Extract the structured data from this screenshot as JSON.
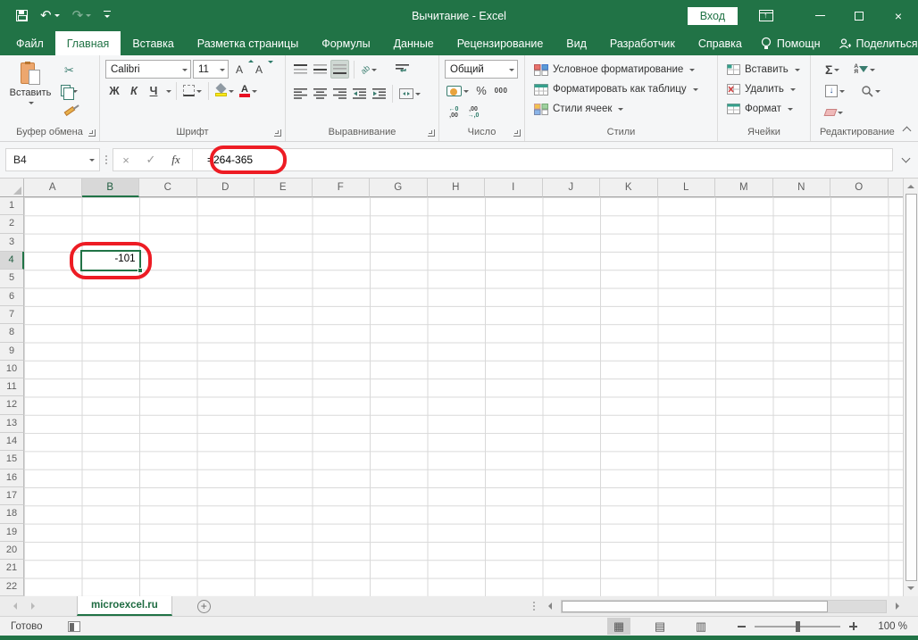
{
  "titlebar": {
    "title": "Вычитание - Excel",
    "signin_label": "Вход"
  },
  "ribbon_tabs": [
    {
      "label": "Файл"
    },
    {
      "label": "Главная"
    },
    {
      "label": "Вставка"
    },
    {
      "label": "Разметка страницы"
    },
    {
      "label": "Формулы"
    },
    {
      "label": "Данные"
    },
    {
      "label": "Рецензирование"
    },
    {
      "label": "Вид"
    },
    {
      "label": "Разработчик"
    },
    {
      "label": "Справка"
    }
  ],
  "tab_actions": {
    "assistant_label": "Помощн",
    "share_label": "Поделиться"
  },
  "ribbon": {
    "clipboard": {
      "group_label": "Буфер обмена",
      "paste_label": "Вставить"
    },
    "font": {
      "group_label": "Шрифт",
      "font_name": "Calibri",
      "font_size": "11",
      "bold_label": "Ж",
      "italic_label": "К",
      "underline_label": "Ч",
      "grow_font_label": "А",
      "shrink_font_label": "А"
    },
    "alignment": {
      "group_label": "Выравнивание",
      "wrap_hint": "ab",
      "orient_hint": "ab"
    },
    "number": {
      "group_label": "Число",
      "format_value": "Общий",
      "percent_label": "%",
      "thousands_label": "000",
      "inc_dec_top": "←0",
      "inc_dec_bottom": ",00",
      "dec_dec_top": ",00",
      "dec_dec_bottom": "→,0"
    },
    "styles": {
      "group_label": "Стили",
      "conditional_label": "Условное форматирование",
      "format_table_label": "Форматировать как таблицу",
      "cell_styles_label": "Стили ячеек"
    },
    "cells": {
      "group_label": "Ячейки",
      "insert_label": "Вставить",
      "delete_label": "Удалить",
      "format_label": "Формат"
    },
    "editing": {
      "group_label": "Редактирование",
      "autosum_label": "Σ",
      "sort_top": "А",
      "sort_bottom": "Я",
      "fill_label": "↓"
    }
  },
  "formula_bar": {
    "name_box_value": "B4",
    "fx_label": "fx",
    "formula_value": "=264-365"
  },
  "grid": {
    "columns": [
      "A",
      "B",
      "C",
      "D",
      "E",
      "F",
      "G",
      "H",
      "I",
      "J",
      "K",
      "L",
      "M",
      "N",
      "O"
    ],
    "row_count": 22,
    "selected": {
      "ref": "B4",
      "column": "B",
      "row": 4,
      "value": "-101"
    }
  },
  "sheet_bar": {
    "active_tab_label": "microexcel.ru"
  },
  "status_bar": {
    "mode_label": "Готово",
    "zoom_label": "100 %"
  },
  "colors": {
    "brand_green": "#217346",
    "annotation_red": "#ed1c24"
  }
}
